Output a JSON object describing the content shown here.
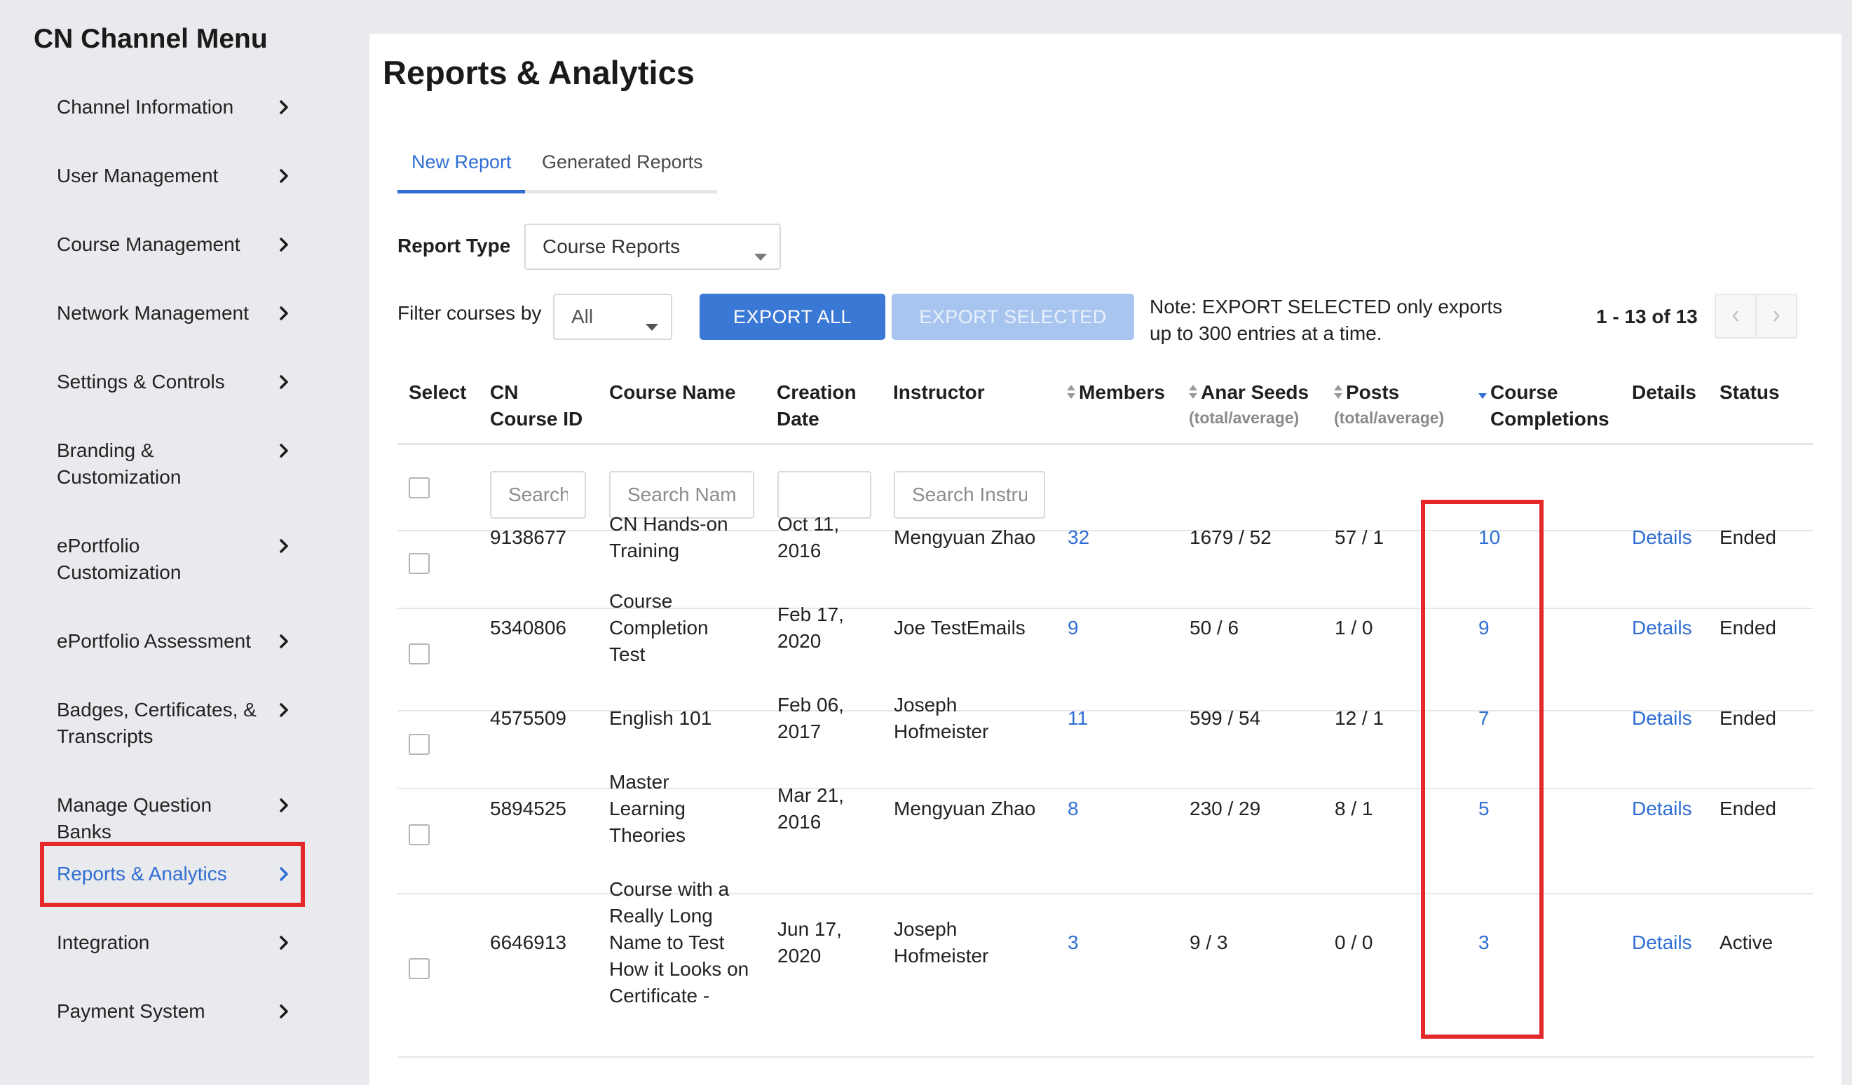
{
  "sidebar": {
    "title": "CN Channel Menu",
    "items": [
      {
        "label": "Channel Information"
      },
      {
        "label": "User Management"
      },
      {
        "label": "Course Management"
      },
      {
        "label": "Network Management"
      },
      {
        "label": "Settings & Controls"
      },
      {
        "label": "Branding & Customization"
      },
      {
        "label": "ePortfolio Customization"
      },
      {
        "label": "ePortfolio Assessment"
      },
      {
        "label": "Badges, Certificates, & Transcripts"
      },
      {
        "label": "Manage Question Banks"
      },
      {
        "label": "Reports & Analytics",
        "active": true
      },
      {
        "label": "Integration"
      },
      {
        "label": "Payment System"
      }
    ]
  },
  "main": {
    "title": "Reports & Analytics",
    "tabs": [
      {
        "label": "New Report",
        "active": true
      },
      {
        "label": "Generated Reports"
      }
    ],
    "report_type": {
      "label": "Report Type",
      "value": "Course Reports"
    },
    "filter": {
      "label": "Filter courses by",
      "value": "All"
    },
    "buttons": {
      "export_all": "EXPORT ALL",
      "export_selected": "EXPORT SELECTED"
    },
    "note": {
      "line1": "Note: EXPORT SELECTED only exports",
      "line2": "up to 300 entries at a time."
    },
    "pagination": {
      "text": "1 - 13 of 13"
    }
  },
  "table": {
    "headers": {
      "select": "Select",
      "course_id": "CN Course ID",
      "course_name": "Course Name",
      "creation_date": "Creation Date",
      "instructor": "Instructor",
      "members": "Members",
      "anar_seeds": "Anar Seeds",
      "anar_seeds_sub": "(total/average)",
      "posts": "Posts",
      "posts_sub": "(total/average)",
      "course_completions": "Course Completions",
      "details": "Details",
      "status": "Status"
    },
    "filters": {
      "course_id_placeholder": "Search",
      "course_name_placeholder": "Search Nam",
      "instructor_placeholder": "Search Instru"
    },
    "rows": [
      {
        "id": "9138677",
        "name": "CN Hands-on Training",
        "date": "Oct 11, 2016",
        "instructor": "Mengyuan Zhao",
        "members": "32",
        "seeds": "1679 / 52",
        "posts": "57 / 1",
        "completions": "10",
        "details": "Details",
        "status": "Ended"
      },
      {
        "id": "5340806",
        "name": "Course Completion Test",
        "date": "Feb 17, 2020",
        "instructor": "Joe TestEmails",
        "members": "9",
        "seeds": "50 / 6",
        "posts": "1 / 0",
        "completions": "9",
        "details": "Details",
        "status": "Ended"
      },
      {
        "id": "4575509",
        "name": "English 101",
        "date": "Feb 06, 2017",
        "instructor": "Joseph Hofmeister",
        "members": "11",
        "seeds": "599 / 54",
        "posts": "12 / 1",
        "completions": "7",
        "details": "Details",
        "status": "Ended"
      },
      {
        "id": "5894525",
        "name": "Master Learning Theories",
        "date": "Mar 21, 2016",
        "instructor": "Mengyuan Zhao",
        "members": "8",
        "seeds": "230 / 29",
        "posts": "8 / 1",
        "completions": "5",
        "details": "Details",
        "status": "Ended"
      },
      {
        "id": "6646913",
        "name": "Course with a Really Long Name to Test How it Looks on Certificate -",
        "date": "Jun 17, 2020",
        "instructor": "Joseph Hofmeister",
        "members": "3",
        "seeds": "9 / 3",
        "posts": "0 / 0",
        "completions": "3",
        "details": "Details",
        "status": "Active"
      }
    ]
  },
  "colors": {
    "accent": "#2f6ed3",
    "highlight": "#e5282a",
    "primary_button": "#3a78d6"
  }
}
